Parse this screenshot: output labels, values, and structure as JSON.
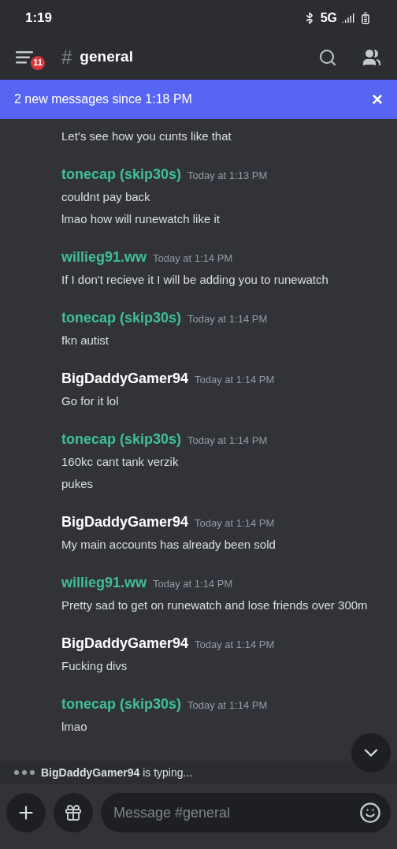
{
  "status_bar": {
    "time": "1:19",
    "network": "5G"
  },
  "header": {
    "hash": "#",
    "channel": "general",
    "unread_badge": "11"
  },
  "banner": {
    "text": "2 new messages since 1:18 PM",
    "close": "×"
  },
  "messages": [
    {
      "kind": "continuation",
      "lines": [
        "Let’s see how you cunts like that"
      ]
    },
    {
      "kind": "group",
      "author": "tonecap (skip30s)",
      "color": "#3fbf9a",
      "time": "Today at 1:13 PM",
      "lines": [
        "couldnt pay back",
        "lmao how will runewatch like it"
      ]
    },
    {
      "kind": "group",
      "author": "willieg91.ww",
      "color": "#3fbf9a",
      "time": "Today at 1:14 PM",
      "lines": [
        "If I don't recieve it I will be adding you to runewatch"
      ]
    },
    {
      "kind": "group",
      "author": "tonecap (skip30s)",
      "color": "#3fbf9a",
      "time": "Today at 1:14 PM",
      "lines": [
        "fkn autist"
      ]
    },
    {
      "kind": "group",
      "author": "BigDaddyGamer94",
      "color": "#ffffff",
      "time": "Today at 1:14 PM",
      "lines": [
        "Go for it lol"
      ]
    },
    {
      "kind": "group",
      "author": "tonecap (skip30s)",
      "color": "#3fbf9a",
      "time": "Today at 1:14 PM",
      "lines": [
        "160kc cant tank verzik",
        "pukes"
      ]
    },
    {
      "kind": "group",
      "author": "BigDaddyGamer94",
      "color": "#ffffff",
      "time": "Today at 1:14 PM",
      "lines": [
        "My main accounts has already been sold"
      ]
    },
    {
      "kind": "group",
      "author": "willieg91.ww",
      "color": "#3fbf9a",
      "time": "Today at 1:14 PM",
      "lines": [
        "Pretty sad to get on runewatch and lose friends over 300m"
      ]
    },
    {
      "kind": "group",
      "author": "BigDaddyGamer94",
      "color": "#ffffff",
      "time": "Today at 1:14 PM",
      "lines": [
        "Fucking divs"
      ]
    },
    {
      "kind": "group",
      "author": "tonecap (skip30s)",
      "color": "#3fbf9a",
      "time": "Today at 1:14 PM",
      "lines": [
        "lmao"
      ]
    }
  ],
  "typing": {
    "user": "BigDaddyGamer94",
    "text": "is typing..."
  },
  "composer": {
    "placeholder": "Message #general"
  }
}
